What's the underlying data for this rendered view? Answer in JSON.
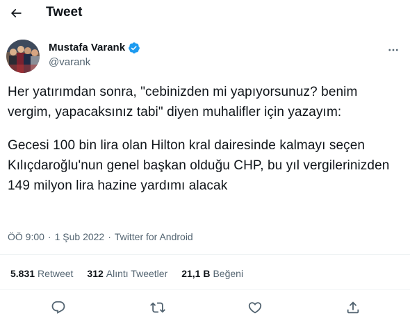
{
  "header": {
    "back_icon": "arrow-left-icon",
    "title": "Tweet"
  },
  "author": {
    "name": "Mustafa Varank",
    "handle": "@varank",
    "verified_icon": "verified-badge-icon",
    "more_icon": "more-horizontal-icon"
  },
  "tweet": {
    "paragraph1": "Her yatırımdan sonra, \"cebinizden mi yapıyorsunuz? benim vergim, yapacaksınız tabi\" diyen muhalifler için yazayım:",
    "paragraph2": "Gecesi 100 bin lira olan Hilton kral dairesinde kalmayı seçen Kılıçdaroğlu'nun genel başkan olduğu CHP, bu yıl vergilerinizden 149 milyon lira hazine yardımı alacak"
  },
  "meta": {
    "time": "ÖÖ 9:00",
    "date": "1 Şub 2022",
    "separator": "·",
    "source": "Twitter for Android"
  },
  "stats": [
    {
      "value": "5.831",
      "label": "Retweet"
    },
    {
      "value": "312",
      "label": "Alıntı Tweetler"
    },
    {
      "value": "21,1 B",
      "label": "Beğeni"
    }
  ],
  "actions": [
    {
      "name": "reply-icon"
    },
    {
      "name": "retweet-icon"
    },
    {
      "name": "like-icon"
    },
    {
      "name": "share-icon"
    }
  ],
  "colors": {
    "text": "#0f1419",
    "secondary": "#536471",
    "verified": "#1d9bf0",
    "divider": "#eff3f4"
  }
}
